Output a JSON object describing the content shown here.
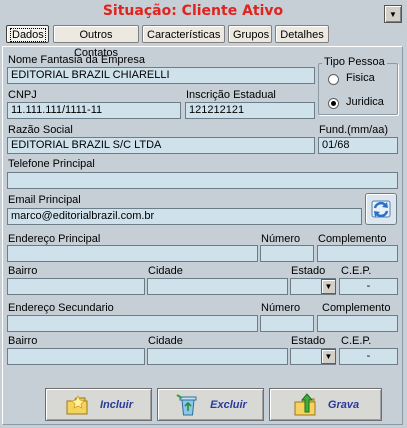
{
  "header": {
    "title": "Situação: Cliente Ativo",
    "dropdown_icon": "chevron-down-icon"
  },
  "tabs": [
    {
      "label": "Dados",
      "active": true
    },
    {
      "label": "Outros Contatos",
      "active": false
    },
    {
      "label": "Características",
      "active": false
    },
    {
      "label": "Grupos",
      "active": false
    },
    {
      "label": "Detalhes",
      "active": false
    }
  ],
  "form": {
    "nome_fantasia": {
      "label": "Nome Fantasia da Empresa",
      "value": "EDITORIAL BRAZIL CHIARELLI"
    },
    "tipo_pessoa": {
      "label": "Tipo Pessoa",
      "options": [
        {
          "label": "Fisica",
          "selected": false
        },
        {
          "label": "Juridica",
          "selected": true
        }
      ]
    },
    "cnpj": {
      "label": "CNPJ",
      "value": "11.111.111/1111-11"
    },
    "inscricao_estadual": {
      "label": "Inscrição Estadual",
      "value": "121212121"
    },
    "razao_social": {
      "label": "Razão Social",
      "value": "EDITORIAL BRAZIL S/C LTDA"
    },
    "fundacao": {
      "label": "Fund.(mm/aa)",
      "value": "01/68"
    },
    "telefone": {
      "label": "Telefone Principal",
      "value": ""
    },
    "email": {
      "label": "Email Principal",
      "value": "marco@editorialbrazil.com.br"
    },
    "endereco_principal": {
      "endereco_label": "Endereço Principal",
      "endereco": "",
      "numero_label": "Número",
      "numero": "",
      "complemento_label": "Complemento",
      "complemento": "",
      "bairro_label": "Bairro",
      "bairro": "",
      "cidade_label": "Cidade",
      "cidade": "",
      "estado_label": "Estado",
      "estado": "",
      "cep_label": "C.E.P.",
      "cep": "-"
    },
    "endereco_secundario": {
      "endereco_label": "Endereço Secundario",
      "endereco": "",
      "numero_label": "Número",
      "numero": "",
      "complemento_label": "Complemento",
      "complemento": "",
      "bairro_label": "Bairro",
      "bairro": "",
      "cidade_label": "Cidade",
      "cidade": "",
      "estado_label": "Estado",
      "estado": "",
      "cep_label": "C.E.P.",
      "cep": "-"
    }
  },
  "buttons": {
    "incluir": "Incluir",
    "excluir": "Excluir",
    "grava": "Grava"
  },
  "colors": {
    "title": "#e0231e",
    "field_bg": "#cfe2ec",
    "window_bg": "#c6cfd6",
    "button_text": "#2a3b9a"
  }
}
